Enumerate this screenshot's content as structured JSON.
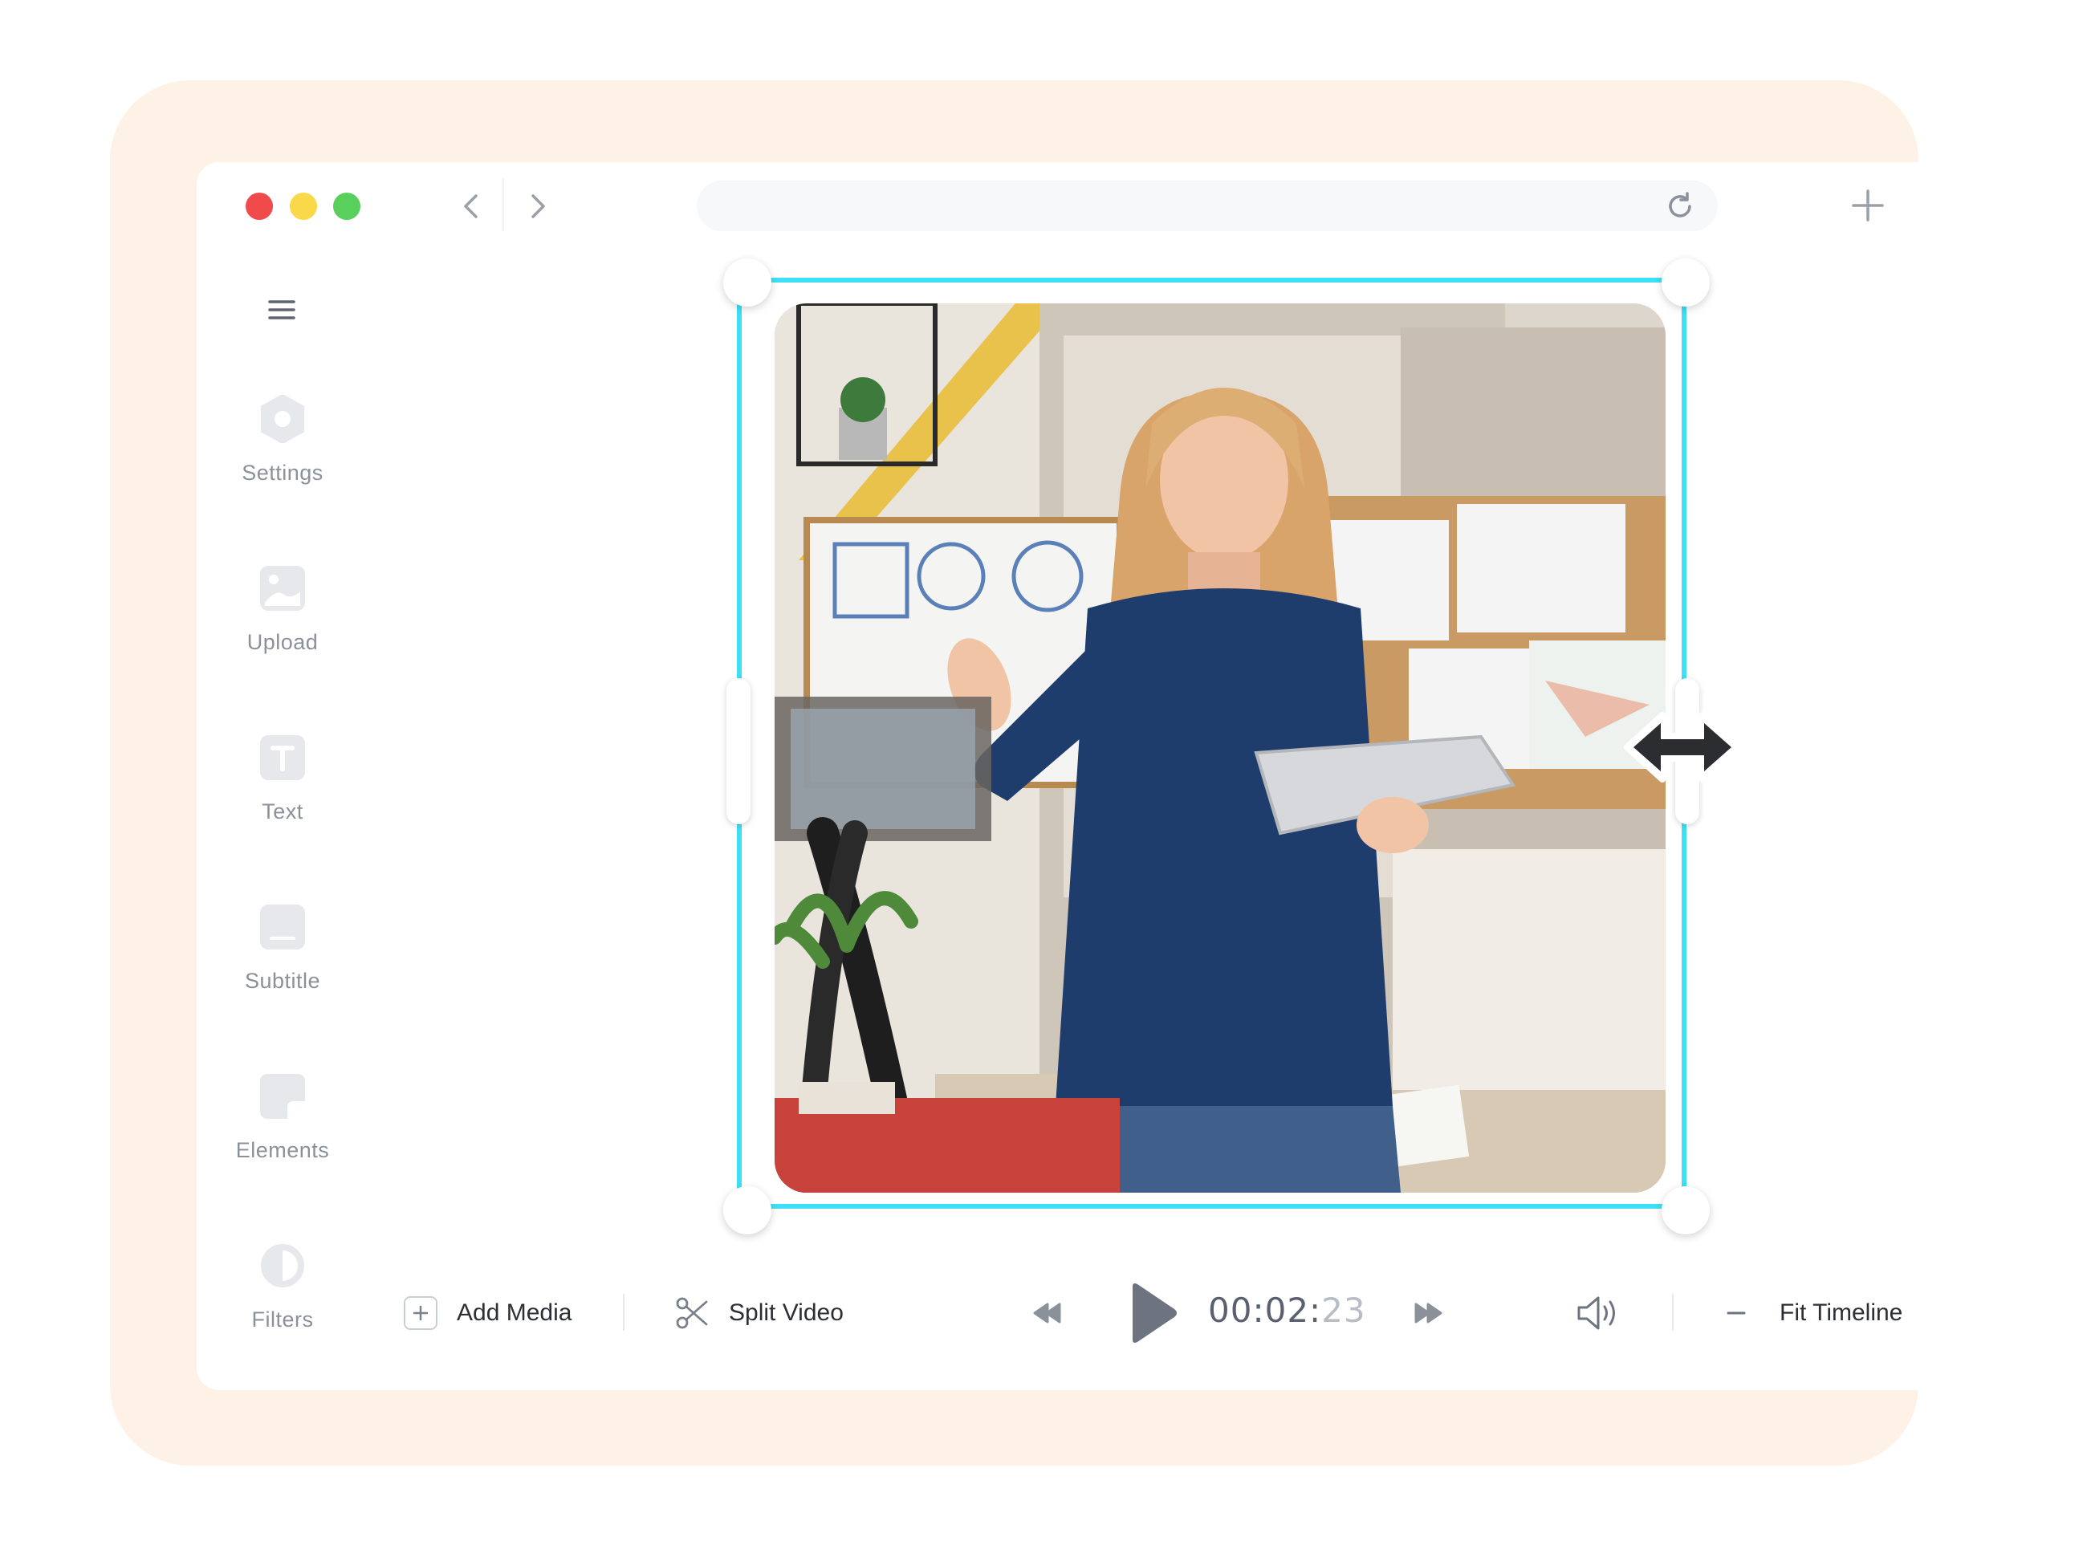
{
  "sidebar": {
    "items": [
      {
        "label": "Settings",
        "icon": "gear-icon"
      },
      {
        "label": "Upload",
        "icon": "image-upload-icon"
      },
      {
        "label": "Text",
        "icon": "text-icon"
      },
      {
        "label": "Subtitle",
        "icon": "subtitle-icon"
      },
      {
        "label": "Elements",
        "icon": "elements-icon"
      },
      {
        "label": "Filters",
        "icon": "filters-icon"
      }
    ]
  },
  "toolbar": {
    "add_media_label": "Add Media",
    "split_video_label": "Split Video",
    "time_main": "00:02:",
    "time_frames": "23",
    "fit_timeline_label": "Fit Timeline"
  },
  "colors": {
    "background_shape": "#fef1e6",
    "selection": "#3ee0f5",
    "traffic_red": "#f04a4a",
    "traffic_yellow": "#f9d94a",
    "traffic_green": "#59cf5c"
  }
}
